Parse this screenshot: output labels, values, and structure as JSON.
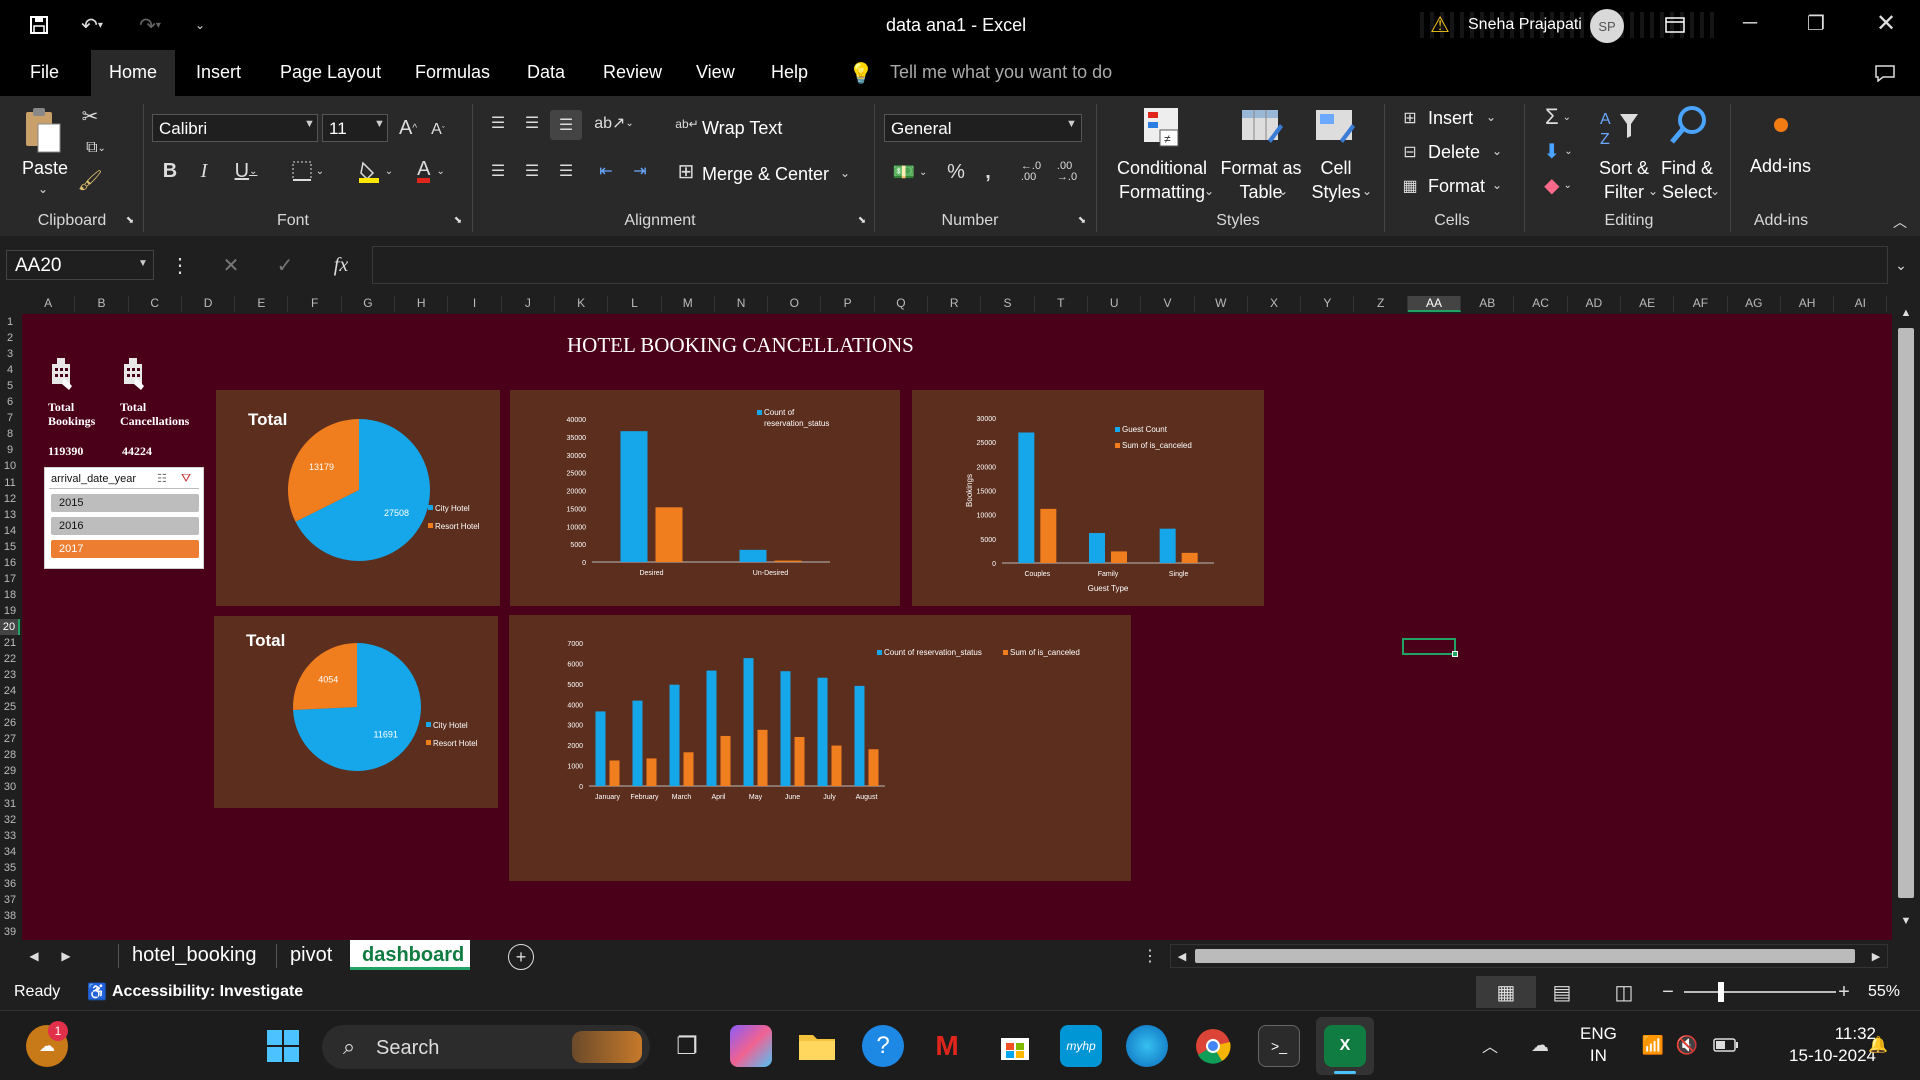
{
  "window": {
    "title": "data ana1  -  Excel",
    "user": "Sneha Prajapati",
    "user_initials": "SP"
  },
  "menu_tabs": [
    "File",
    "Home",
    "Insert",
    "Page Layout",
    "Formulas",
    "Data",
    "Review",
    "View",
    "Help"
  ],
  "tell_me": "Tell me what you want to do",
  "ribbon": {
    "clipboard": {
      "label": "Clipboard",
      "paste": "Paste"
    },
    "font": {
      "label": "Font",
      "name": "Calibri",
      "size": "11"
    },
    "alignment": {
      "label": "Alignment",
      "wrap": "Wrap Text",
      "merge": "Merge & Center"
    },
    "number": {
      "label": "Number",
      "format": "General"
    },
    "styles": {
      "label": "Styles",
      "cond1": "Conditional",
      "cond2": "Formatting",
      "fmt1": "Format as",
      "fmt2": "Table",
      "cell1": "Cell",
      "cell2": "Styles"
    },
    "cells": {
      "label": "Cells",
      "insert": "Insert",
      "delete": "Delete",
      "format": "Format"
    },
    "editing": {
      "label": "Editing",
      "sort1": "Sort &",
      "sort2": "Filter",
      "find1": "Find &",
      "find2": "Select"
    },
    "addins": {
      "label": "Add-ins",
      "btn": "Add-ins"
    }
  },
  "formula_bar": {
    "name_box": "AA20",
    "fx": "fx",
    "value": ""
  },
  "columns": [
    "A",
    "B",
    "C",
    "D",
    "E",
    "F",
    "G",
    "H",
    "I",
    "J",
    "K",
    "L",
    "M",
    "N",
    "O",
    "P",
    "Q",
    "R",
    "S",
    "T",
    "U",
    "V",
    "W",
    "X",
    "Y",
    "Z",
    "AA",
    "AB",
    "AC",
    "AD",
    "AE",
    "AF",
    "AG",
    "AH",
    "AI"
  ],
  "rows": [
    "1",
    "2",
    "3",
    "4",
    "5",
    "6",
    "7",
    "8",
    "9",
    "10",
    "11",
    "12",
    "13",
    "14",
    "15",
    "16",
    "17",
    "18",
    "19",
    "20",
    "21",
    "22",
    "23",
    "24",
    "25",
    "26",
    "27",
    "28",
    "29",
    "30",
    "31",
    "32",
    "33",
    "34",
    "35",
    "36",
    "37",
    "38",
    "39"
  ],
  "dashboard": {
    "title": "HOTEL BOOKING CANCELLATIONS",
    "kpi1_l1": "Total",
    "kpi1_l2": "Bookings",
    "kpi1_value": "119390",
    "kpi2_l1": "Total",
    "kpi2_l2": "Cancellations",
    "kpi2_value": "44224",
    "slicer": {
      "title": "arrival_date_year",
      "items": [
        "2015",
        "2016",
        "2017"
      ],
      "selected": "2017"
    }
  },
  "chart_data": [
    {
      "type": "pie",
      "title": "Total",
      "labels": [
        "City Hotel",
        "Resort Hotel"
      ],
      "values": [
        27508,
        13179
      ],
      "colors": [
        "#16a7ea",
        "#f07d1e"
      ]
    },
    {
      "type": "bar",
      "categories": [
        "Desired",
        "Un-Desired"
      ],
      "series": [
        {
          "name": "Count of reservation_status",
          "values": [
            36600,
            3400
          ]
        },
        {
          "name": "",
          "values": [
            15300,
            400
          ]
        }
      ],
      "ylim": [
        0,
        40000
      ],
      "yticks": [
        0,
        5000,
        10000,
        15000,
        20000,
        25000,
        30000,
        35000,
        40000
      ]
    },
    {
      "type": "bar",
      "categories": [
        "Couples",
        "Family",
        "Single"
      ],
      "series": [
        {
          "name": "Guest Count",
          "values": [
            27000,
            6200,
            7100
          ]
        },
        {
          "name": "Sum of is_canceled",
          "values": [
            11200,
            2400,
            2100
          ]
        }
      ],
      "ylim": [
        0,
        30000
      ],
      "yticks": [
        0,
        5000,
        10000,
        15000,
        20000,
        25000,
        30000
      ],
      "xlabel": "Guest Type",
      "ylabel": "Bookings"
    },
    {
      "type": "pie",
      "title": "Total",
      "labels": [
        "City Hotel",
        "Resort Hotel"
      ],
      "values": [
        11691,
        4054
      ],
      "colors": [
        "#16a7ea",
        "#f07d1e"
      ]
    },
    {
      "type": "bar",
      "categories": [
        "January",
        "February",
        "March",
        "April",
        "May",
        "June",
        "July",
        "August"
      ],
      "series": [
        {
          "name": "Count of reservation_status",
          "values": [
            3650,
            4180,
            4960,
            5650,
            6260,
            5620,
            5300,
            4900
          ]
        },
        {
          "name": "Sum of is_canceled",
          "values": [
            1250,
            1350,
            1650,
            2450,
            2750,
            2400,
            1980,
            1800
          ]
        }
      ],
      "ylim": [
        0,
        7000
      ],
      "yticks": [
        0,
        1000,
        2000,
        3000,
        4000,
        5000,
        6000,
        7000
      ]
    }
  ],
  "sheet_tabs": [
    "hotel_booking",
    "pivot",
    "dashboard"
  ],
  "active_sheet": "dashboard",
  "status": {
    "ready": "Ready",
    "accessibility": "Accessibility: Investigate",
    "zoom": "55%"
  },
  "taskbar": {
    "search": "Search",
    "lang1": "ENG",
    "lang2": "IN",
    "time": "11:32",
    "date": "15-10-2024",
    "badge": "1"
  }
}
